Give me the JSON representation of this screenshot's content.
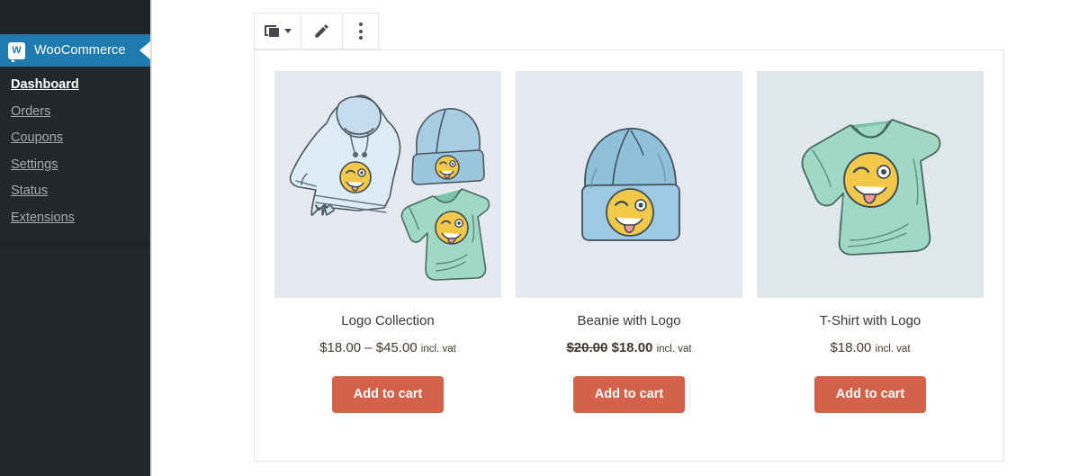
{
  "sidebar": {
    "brand": {
      "logo_icon": "woocommerce-logo-icon",
      "logo_letter": "W",
      "title": "WooCommerce",
      "accent_color": "#1f7ab0"
    },
    "items": [
      {
        "label": "Dashboard",
        "active": true
      },
      {
        "label": "Orders",
        "active": false
      },
      {
        "label": "Coupons",
        "active": false
      },
      {
        "label": "Settings",
        "active": false
      },
      {
        "label": "Status",
        "active": false
      },
      {
        "label": "Extensions",
        "active": false
      }
    ],
    "ghost_items": [
      "",
      "",
      "",
      "",
      "",
      ""
    ],
    "background_color": "#23282d"
  },
  "toolbar": {
    "products_button": {
      "icon": "products-stack-icon",
      "caret_icon": "chevron-down-icon"
    },
    "edit_button": {
      "icon": "pencil-icon"
    },
    "more_button": {
      "icon": "more-vertical-icon"
    }
  },
  "products": [
    {
      "image_name": "logo-collection-image",
      "image_alt_bg": false,
      "title": "Logo Collection",
      "price_old": "",
      "price": "$18.00 – $45.00",
      "price_suffix": "incl. vat",
      "on_sale": false,
      "button_label": "Add to cart"
    },
    {
      "image_name": "beanie-with-logo-image",
      "image_alt_bg": false,
      "title": "Beanie with Logo",
      "price_old": "$20.00",
      "price": "$18.00",
      "price_suffix": "incl. vat",
      "on_sale": true,
      "button_label": "Add to cart"
    },
    {
      "image_name": "t-shirt-with-logo-image",
      "image_alt_bg": true,
      "title": "T-Shirt with Logo",
      "price_old": "",
      "price": "$18.00",
      "price_suffix": "incl. vat",
      "on_sale": false,
      "button_label": "Add to cart"
    }
  ],
  "colors": {
    "button": "#d4624a",
    "price_text": "#42392f",
    "title_text": "#3c3733"
  }
}
